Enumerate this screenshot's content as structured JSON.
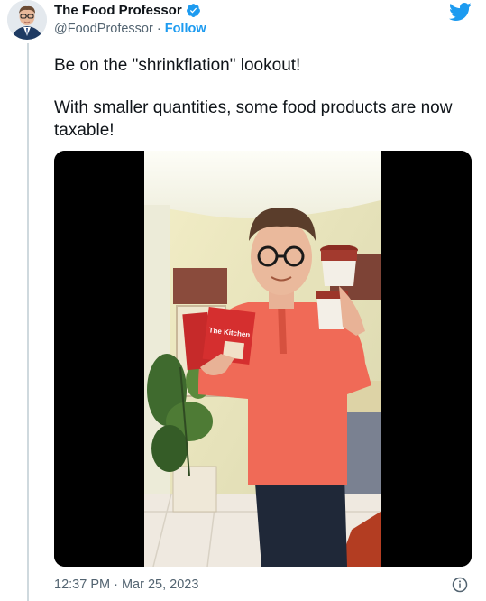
{
  "author": {
    "display_name": "The Food Professor",
    "handle": "@FoodProfessor",
    "separator": " · ",
    "follow_label": "Follow"
  },
  "tweet": {
    "paragraph_1": "Be on the \"shrinkflation\" lookout!",
    "paragraph_2": "With smaller quantities, some food products are now taxable!"
  },
  "media": {
    "type": "video",
    "product_left_text": "The Kitchen"
  },
  "meta": {
    "timestamp": "12:37 PM · Mar 25, 2023"
  },
  "icons": {
    "verified": "verified-badge-icon",
    "brand": "twitter-bird-icon",
    "info": "info-icon"
  },
  "colors": {
    "accent": "#1d9bf0",
    "text": "#0f1419",
    "secondary_text": "#536471"
  }
}
